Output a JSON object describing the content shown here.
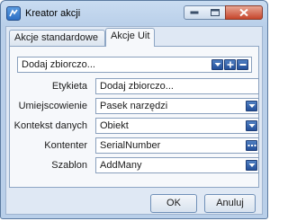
{
  "window": {
    "title": "Kreator akcji"
  },
  "tabs": [
    "Akcje standardowe",
    "Akcje Uit"
  ],
  "action_combo": {
    "value": "Dodaj zbiorczo..."
  },
  "form": {
    "rows": [
      {
        "label": "Etykieta",
        "value": "Dodaj zbiorczo...",
        "control": "text"
      },
      {
        "label": "Umiejscowienie",
        "value": "Pasek narzędzi",
        "control": "dropdown"
      },
      {
        "label": "Kontekst danych",
        "value": "Obiekt",
        "control": "dropdown"
      },
      {
        "label": "Kontenter",
        "value": "SerialNumber",
        "control": "browse"
      },
      {
        "label": "Szablon",
        "value": "AddMany",
        "control": "dropdown"
      }
    ]
  },
  "buttons": {
    "ok": "OK",
    "cancel": "Anuluj"
  }
}
